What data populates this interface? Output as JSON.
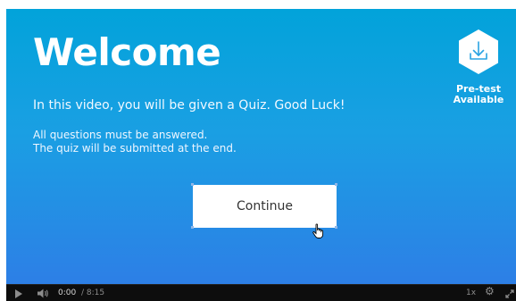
{
  "slide": {
    "title": "Welcome",
    "intro": "In this video, you will be given a Quiz. Good Luck!",
    "rules": [
      "All questions must be answered.",
      "The quiz will be submitted at the end."
    ],
    "continue_label": "Continue"
  },
  "pretest": {
    "label_line1": "Pre-test",
    "label_line2": "Available",
    "icon": "download-tray-icon"
  },
  "player_controls": {
    "current_time": "0:00",
    "duration": "/ 8:15",
    "speed": "1x",
    "icons": [
      "play-icon",
      "volume-icon",
      "gear-icon",
      "fullscreen-icon"
    ]
  },
  "colors": {
    "stage_top": "#02a3da",
    "stage_bottom": "#2d7fe6",
    "badge": "#ffffff",
    "badge_icon": "#2aa3e3"
  }
}
